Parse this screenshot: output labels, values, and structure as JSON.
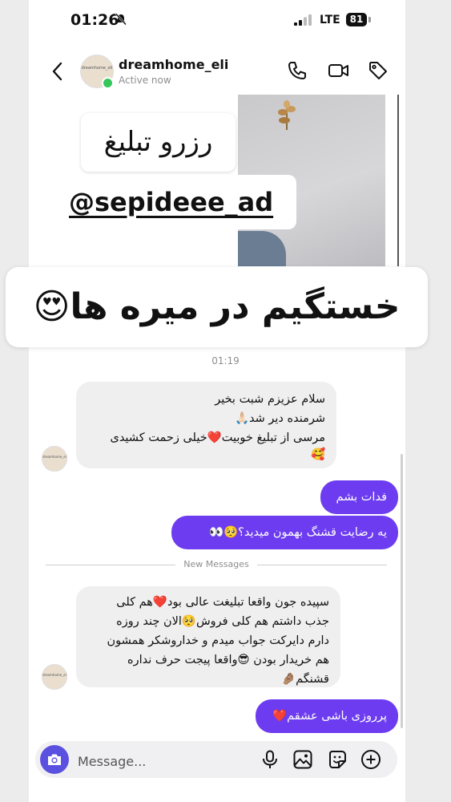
{
  "status": {
    "time": "01:26",
    "network": "LTE",
    "battery": "81"
  },
  "header": {
    "username": "dreamhome_eli",
    "status": "Active now",
    "avatar_text": "dreamhome_eli"
  },
  "story": {
    "sticker_reserve": "رزرو تبلیغ",
    "sticker_handle": "@sepideee_ad",
    "caption": "خستگیم در میره ها😍"
  },
  "conversation": {
    "timestamp": "01:19",
    "new_messages_label": "New Messages",
    "messages": [
      {
        "from": "them",
        "lines": [
          "سلام عزیزم شبت بخیر",
          "شرمنده دیر شد🙏🏻",
          "مرسی از تبلیغ خوبیت❤️خیلی زحمت کشیدی",
          "🥰"
        ]
      },
      {
        "from": "me",
        "text": "فدات بشم"
      },
      {
        "from": "me",
        "text": "یه رضایت قشنگ بهمون میدید؟🥺👀"
      },
      {
        "from": "them",
        "lines": [
          "سپیده جون واقعا تبلیغت عالی بود❤️هم کلی",
          "جذب داشتم هم کلی فروش🥺الان چند روزه",
          "دارم دایرکت جواب میدم و خداروشکر همشون",
          "هم خریدار بودن 😎واقعا پیجت حرف نداره",
          "قشنگم🤌🏽"
        ]
      },
      {
        "from": "me",
        "text": "پرروزی باشی عشقم❤️"
      }
    ]
  },
  "composer": {
    "placeholder": "Message..."
  },
  "icons": {
    "back": "chevron-left-icon",
    "call": "phone-icon",
    "video": "video-camera-icon",
    "tag": "tag-icon",
    "camera": "camera-icon",
    "mic": "microphone-icon",
    "gallery": "image-icon",
    "sticker": "sticker-icon",
    "add": "plus-circle-icon"
  },
  "colors": {
    "outgoing_bubble": "#6d3cf0",
    "incoming_bubble": "#efeff0",
    "camera_button": "#5b51e0",
    "online": "#35c759"
  }
}
